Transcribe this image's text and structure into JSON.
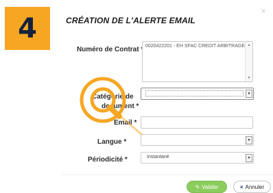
{
  "step": {
    "number": "4"
  },
  "dialog": {
    "title": "CRÉATION DE L'ALERTE EMAIL",
    "close_glyph": "×"
  },
  "form": {
    "contract": {
      "label": "Numéro de Contrat *",
      "option": "0020422201 - EH SFAC CREDIT ARBITRAGE CAP E"
    },
    "category": {
      "label_line1": "Catégorie de",
      "label_line2": "document *",
      "value": ""
    },
    "email": {
      "label": "Email *",
      "value": ""
    },
    "language": {
      "label": "Langue *",
      "value": ""
    },
    "periodicity": {
      "label": "Périodicité *",
      "value": "Instantané"
    }
  },
  "buttons": {
    "validate": {
      "label": "Valider",
      "icon": "pencil-icon"
    },
    "cancel": {
      "label": "Annuler",
      "icon": "x-icon",
      "glyph": "×"
    }
  },
  "colors": {
    "badge": "#f6a623",
    "highlight": "#f6a623",
    "validate": "#8ccc5e"
  }
}
